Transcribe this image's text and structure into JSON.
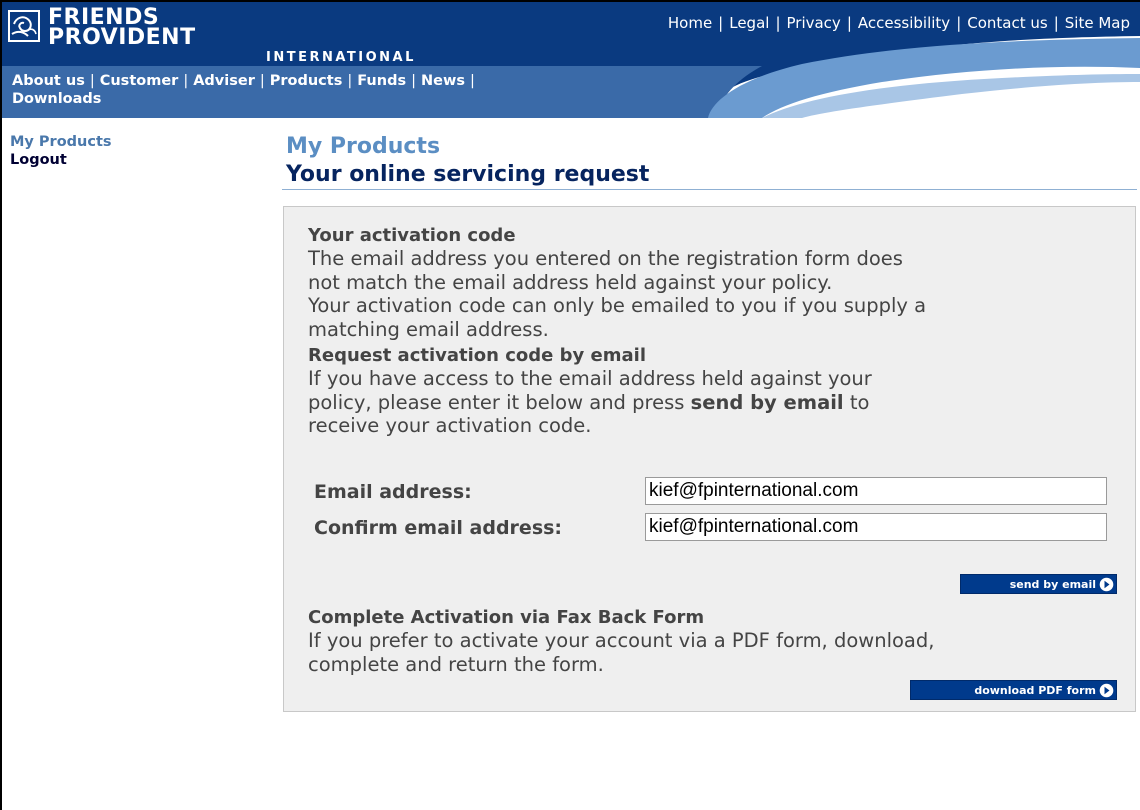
{
  "header": {
    "logo_line1": "FRIENDS",
    "logo_line2": "PROVIDENT",
    "logo_sub": "INTERNATIONAL",
    "utility_links": [
      "Home",
      "Legal",
      "Privacy",
      "Accessibility",
      "Contact us",
      "Site Map"
    ],
    "separator": "|",
    "main_nav": [
      "About us",
      "Customer",
      "Adviser",
      "Products",
      "Funds",
      "News",
      "Downloads"
    ]
  },
  "left_nav": {
    "current": "My Products",
    "logout": "Logout"
  },
  "page": {
    "section": "My Products",
    "title": "Your online servicing request"
  },
  "activation": {
    "heading": "Your activation code",
    "line1": "The email address you entered on the registration form does",
    "line2": "not match the email address held against your policy.",
    "line3": "Your activation code can only be emailed to you if you supply a",
    "line4": "matching email address."
  },
  "request": {
    "heading": "Request activation code by email",
    "line1": "If you have access to the email address held against your",
    "line2_pre": "policy, please enter it below and press ",
    "line2_bold": "send by email",
    "line2_post": " to",
    "line3": "receive your activation code."
  },
  "form": {
    "email_label": "Email address:",
    "email_value": "kief@fpinternational.com",
    "confirm_label": "Confirm email address:",
    "confirm_value": "kief@fpinternational.com",
    "send_button": "send by email"
  },
  "fax": {
    "heading": "Complete Activation via Fax Back Form",
    "line1": "If you prefer to activate your account via a PDF form, download,",
    "line2": "complete and return the form.",
    "download_button": "download PDF form"
  },
  "colors": {
    "header_dark": "#0a3a80",
    "header_light": "#6b9bd0",
    "button": "#003a8c",
    "heading_light": "#5b8ec3",
    "heading_dark": "#06245f"
  }
}
